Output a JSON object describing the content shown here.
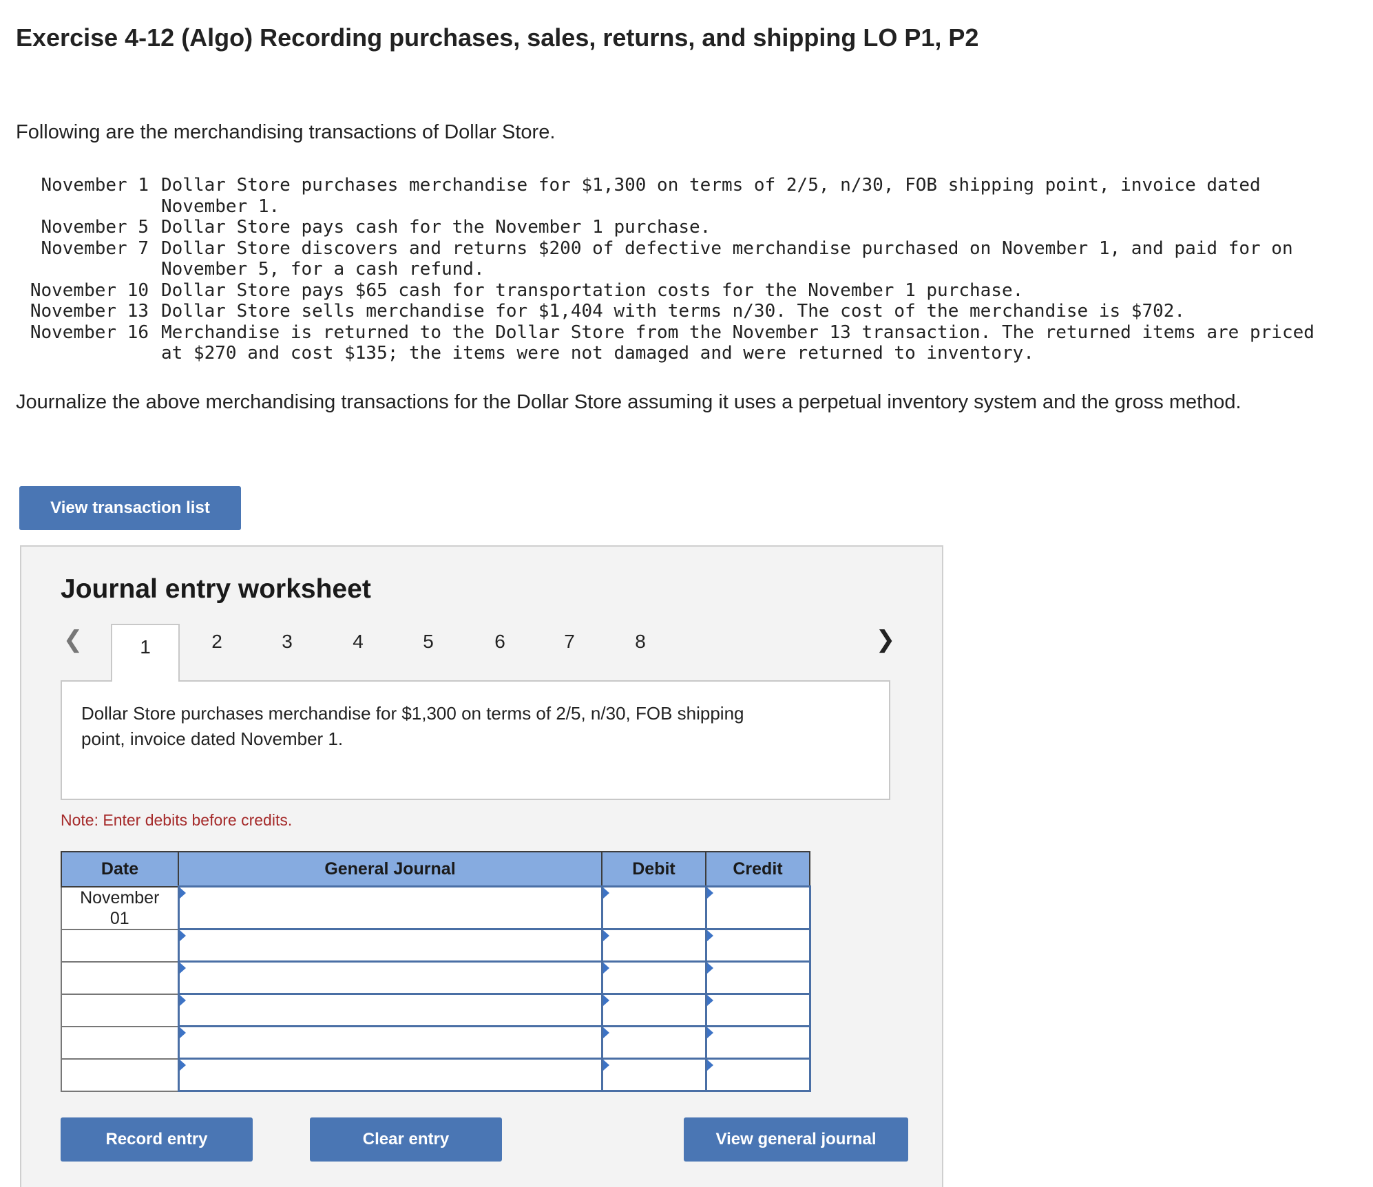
{
  "title": "Exercise 4-12 (Algo) Recording purchases, sales, returns, and shipping LO P1, P2",
  "intro": "Following are the merchandising transactions of Dollar Store.",
  "transactions": [
    {
      "date": "November 1",
      "text": "Dollar Store purchases merchandise for $1,300 on terms of 2/5, n/30, FOB shipping point, invoice dated November 1."
    },
    {
      "date": "November 5",
      "text": "Dollar Store pays cash for the November 1 purchase."
    },
    {
      "date": "November 7",
      "text": "Dollar Store discovers and returns $200 of defective merchandise purchased on November 1, and paid for on November 5, for a cash refund."
    },
    {
      "date": "November 10",
      "text": "Dollar Store pays $65 cash for transportation costs for the November 1 purchase."
    },
    {
      "date": "November 13",
      "text": "Dollar Store sells merchandise for $1,404 with terms n/30. The cost of the merchandise is $702."
    },
    {
      "date": "November 16",
      "text": "Merchandise is returned to the Dollar Store from the November 13 transaction. The returned items are priced at $270 and cost $135; the items were not damaged and were returned to inventory."
    }
  ],
  "instructions": "Journalize the above merchandising transactions for the Dollar Store assuming it uses a perpetual inventory system and the gross method.",
  "buttons": {
    "view_transaction_list": "View transaction list",
    "record_entry": "Record entry",
    "clear_entry": "Clear entry",
    "view_general_journal": "View general journal"
  },
  "worksheet": {
    "title": "Journal entry worksheet",
    "tabs": [
      "1",
      "2",
      "3",
      "4",
      "5",
      "6",
      "7",
      "8"
    ],
    "active_tab": "1",
    "description": "Dollar Store purchases merchandise for $1,300 on terms of 2/5, n/30, FOB shipping point, invoice dated November 1.",
    "note": "Note: Enter debits before credits.",
    "table": {
      "headers": [
        "Date",
        "General Journal",
        "Debit",
        "Credit"
      ],
      "first_date_line1": "November",
      "first_date_line2": "01"
    }
  }
}
